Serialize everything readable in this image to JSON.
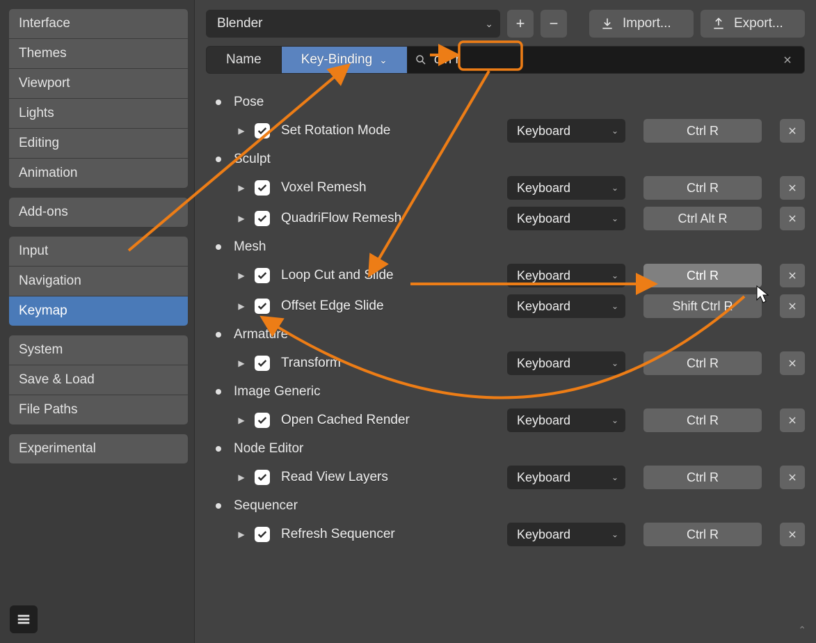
{
  "sidebar": {
    "groups": [
      [
        "Interface",
        "Themes",
        "Viewport",
        "Lights",
        "Editing",
        "Animation"
      ],
      [
        "Add-ons"
      ],
      [
        "Input",
        "Navigation",
        "Keymap"
      ],
      [
        "System",
        "Save & Load",
        "File Paths"
      ],
      [
        "Experimental"
      ]
    ],
    "active": "Keymap"
  },
  "topbar": {
    "preset": "Blender",
    "import_label": "Import...",
    "export_label": "Export..."
  },
  "search": {
    "mode_name": "Name",
    "mode_key": "Key-Binding",
    "active_mode": "Key-Binding",
    "value": "ctrl r"
  },
  "keymap": [
    {
      "category": "Pose",
      "entries": [
        {
          "name": "Set Rotation Mode",
          "input": "Keyboard",
          "shortcut": "Ctrl R"
        }
      ]
    },
    {
      "category": "Sculpt",
      "entries": [
        {
          "name": "Voxel Remesh",
          "input": "Keyboard",
          "shortcut": "Ctrl R"
        },
        {
          "name": "QuadriFlow Remesh",
          "input": "Keyboard",
          "shortcut": "Ctrl Alt R"
        }
      ]
    },
    {
      "category": "Mesh",
      "entries": [
        {
          "name": "Loop Cut and Slide",
          "input": "Keyboard",
          "shortcut": "Ctrl R",
          "highlight": true
        },
        {
          "name": "Offset Edge Slide",
          "input": "Keyboard",
          "shortcut": "Shift Ctrl R"
        }
      ]
    },
    {
      "category": "Armature",
      "entries": [
        {
          "name": "Transform",
          "input": "Keyboard",
          "shortcut": "Ctrl R"
        }
      ]
    },
    {
      "category": "Image Generic",
      "entries": [
        {
          "name": "Open Cached Render",
          "input": "Keyboard",
          "shortcut": "Ctrl R"
        }
      ]
    },
    {
      "category": "Node Editor",
      "entries": [
        {
          "name": "Read View Layers",
          "input": "Keyboard",
          "shortcut": "Ctrl R"
        }
      ]
    },
    {
      "category": "Sequencer",
      "entries": [
        {
          "name": "Refresh Sequencer",
          "input": "Keyboard",
          "shortcut": "Ctrl R"
        }
      ]
    }
  ],
  "icons": {
    "plus": "+",
    "minus": "−"
  },
  "annotation_color": "#ed7d16"
}
